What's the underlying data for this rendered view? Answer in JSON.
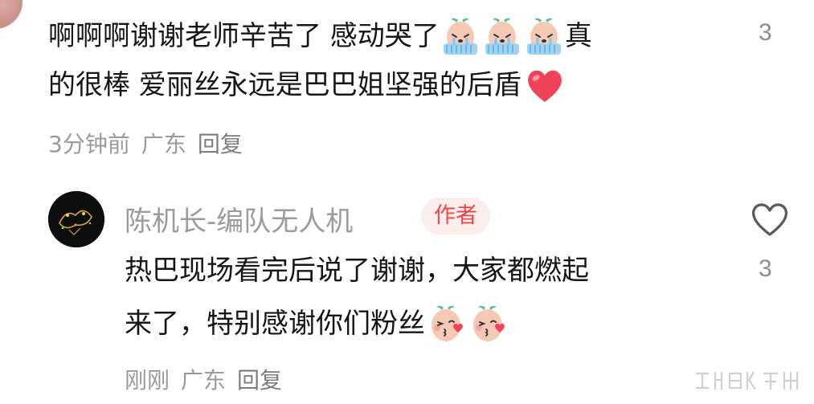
{
  "comment1": {
    "line1_text_a": "啊啊啊谢谢老师辛苦了 感动哭了",
    "line1_text_b": "真",
    "line2_text": "的很棒 爱丽丝永远是巴巴姐坚强的后盾",
    "emojis_line1": [
      "crying-emoji",
      "crying-emoji",
      "crying-emoji"
    ],
    "emoji_line2": "red-heart-emoji",
    "time": "3分钟前",
    "location": "广东",
    "reply_label": "回复",
    "like_count": "3"
  },
  "reply": {
    "author": "陈机长-编队无人机",
    "author_badge": "作者",
    "line1_text": "热巴现场看完后说了谢谢，大家都燃起",
    "line2_text": "来了，特别感谢你们粉丝",
    "emojis": [
      "blowing-kiss-emoji",
      "blowing-kiss-emoji"
    ],
    "time": "刚刚",
    "location": "广东",
    "reply_label": "回复",
    "like_count": "3",
    "like_icon": "heart-outline-icon"
  },
  "colors": {
    "text": "#161616",
    "meta": "#9a9a9a",
    "badge_text": "#f24646",
    "badge_bg": "#fdeeee",
    "heart": "#f0435a"
  }
}
